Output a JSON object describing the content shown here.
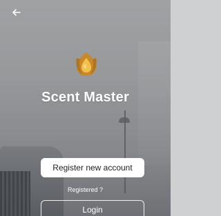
{
  "header": {
    "back_icon": "arrow-left-icon"
  },
  "brand": {
    "logo_icon": "scent-drop-logo-icon",
    "title": "Scent Master",
    "accent_color": "#e0a53a"
  },
  "actions": {
    "register_label": "Register new account",
    "registered_prompt": "Registered ?",
    "login_label": "Login"
  }
}
